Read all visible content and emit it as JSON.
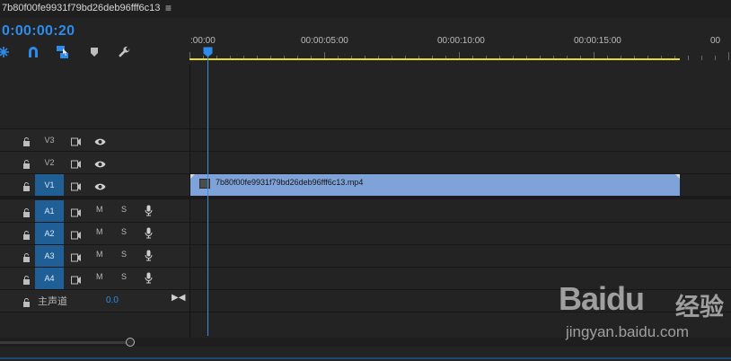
{
  "sequence": {
    "title": "7b80f00fe9931f79bd26deb96fff6c13",
    "menu_icon": "hamburger-icon",
    "timecode": "0:00:00:20"
  },
  "toolbar": [
    {
      "name": "snap-icon"
    },
    {
      "name": "magnet-icon"
    },
    {
      "name": "linked-selection-icon"
    },
    {
      "name": "add-marker-icon"
    },
    {
      "name": "wrench-icon"
    }
  ],
  "ruler": {
    "labels": [
      ":00:00",
      "00:00:05:00",
      "00:00:10:00",
      "00:00:15:00",
      "00"
    ]
  },
  "tracks": {
    "video": [
      {
        "label": "V3",
        "active": false
      },
      {
        "label": "V2",
        "active": false
      },
      {
        "label": "V1",
        "active": true
      }
    ],
    "audio": [
      {
        "label": "A1",
        "active": true,
        "mute": "M",
        "solo": "S"
      },
      {
        "label": "A2",
        "active": true,
        "mute": "M",
        "solo": "S"
      },
      {
        "label": "A3",
        "active": true,
        "mute": "M",
        "solo": "S"
      },
      {
        "label": "A4",
        "active": true,
        "mute": "M",
        "solo": "S"
      }
    ],
    "master": {
      "label": "主声道",
      "value": "0.0"
    }
  },
  "clip": {
    "name": "7b80f00fe9931f79bd26deb96fff6c13.mp4",
    "color": "#7fa3d9"
  },
  "colors": {
    "accent": "#2d8ceb",
    "work_area": "#e8d936",
    "track_active": "#1f5f96"
  },
  "watermark": {
    "logo": "Baidu",
    "cn": "经验",
    "url": "jingyan.baidu.com"
  }
}
